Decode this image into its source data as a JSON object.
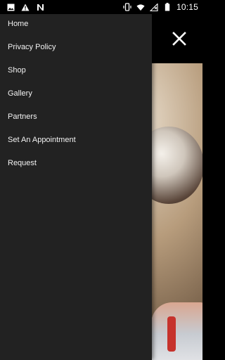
{
  "status_bar": {
    "time": "10:15",
    "left_icons": [
      "image-icon",
      "warning-icon",
      "n-icon"
    ],
    "right_icons": [
      "vibrate-icon",
      "wifi-icon",
      "no-signal-icon",
      "battery-icon"
    ]
  },
  "drawer": {
    "items": [
      {
        "label": "Home"
      },
      {
        "label": "Privacy Policy"
      },
      {
        "label": "Shop"
      },
      {
        "label": "Gallery"
      },
      {
        "label": "Partners"
      },
      {
        "label": "Set An Appointment"
      },
      {
        "label": "Request"
      }
    ]
  },
  "appbar": {
    "close_icon": "close-icon"
  },
  "colors": {
    "drawer_bg": "#222222",
    "appbar_bg": "#000000",
    "text": "#f2f2f2"
  }
}
